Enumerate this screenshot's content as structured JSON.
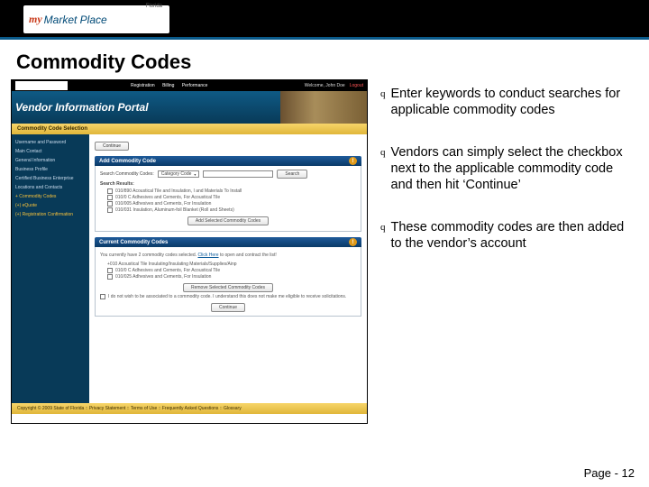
{
  "header": {
    "logo_prefix": "my",
    "logo_text": "Market Place",
    "logo_sup": "Florida"
  },
  "title": "Commodity Codes",
  "screenshot": {
    "nav": {
      "item1": "Registration",
      "item2": "Billing",
      "item3": "Performance"
    },
    "welcome": "Welcome, John Doe",
    "logout": "Logout",
    "banner_title": "Vendor Information Portal",
    "section_bar": "Commodity Code Selection",
    "sidebar": {
      "i0": "Username and Password",
      "i1": "Main Contact",
      "i2": "General Information",
      "i3": "Business Profile",
      "i4": "Certified Business Enterprise",
      "i5": "Locations and Contacts",
      "i6": "+ Commodity Codes",
      "i7": "(+) eQuote",
      "i8": "(+) Registration Confirmation"
    },
    "continue_btn": "Continue",
    "panel_add": "Add Commodity Code",
    "search_label": "Search Commodity Codes:",
    "search_mode": "Category Code",
    "search_btn": "Search",
    "results_label": "Search Results:",
    "r1": "010/890 Acoustical Tile and Insulation, I and Materials To Install",
    "r2": "010/0 C Adhesives and Cements, For Acoustical Tile",
    "r3": "010/005 Adhesives and Cements, For Insulation",
    "r4": "010/031 Insulation, Aluminum-foil Blanket (Roll and Sheets)",
    "add_selected_btn": "Add Selected Commodity Codes",
    "panel_current": "Current Commodity Codes",
    "current_note_a": "You currently have 2 commodity codes selected.",
    "current_note_b": "Click Here",
    "current_note_c": " to open and contract the list!",
    "c1": "+010 Acoustical Tile Insulating/Insulating Materials/Supplies/Ainp",
    "c2": "010/0 C Adhesives and Cements, For Acoustical Tile",
    "c3": "010/025 Adhesives and Cements, For Insulation",
    "remove_btn": "Remove Selected Commodity Codes",
    "disclaimer": "I do not wish to be associated to a commodity code. I understand this does not make me eligible to receive solicitations.",
    "footer": "Copyright © 2009 State of Florida :: Privacy Statement :: Terms of Use :: Frequently Asked Questions :: Glossary"
  },
  "bullets": {
    "mark": "q",
    "b1": "Enter keywords to conduct searches for applicable commodity codes",
    "b2": "Vendors can simply select the checkbox next to the applicable commodity code and then hit ‘Continue’",
    "b3": "These commodity codes are then added to the vendor’s account"
  },
  "page_label": "Page - 12"
}
